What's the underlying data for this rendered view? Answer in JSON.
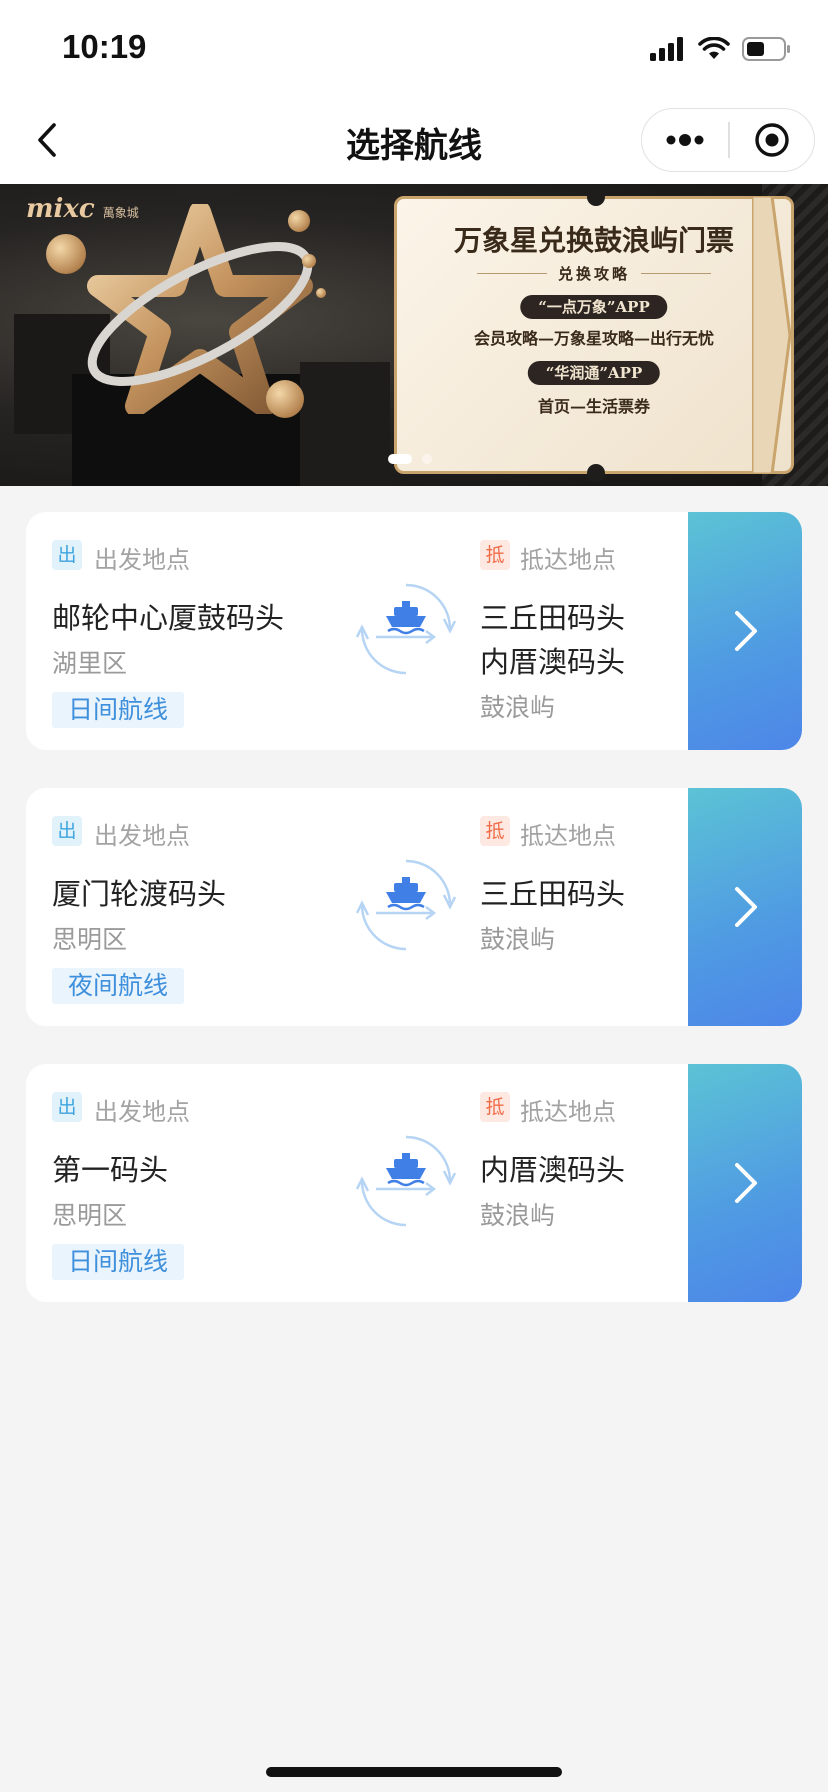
{
  "status_bar": {
    "time": "10:19"
  },
  "nav": {
    "title": "选择航线"
  },
  "banner": {
    "brand": "mixc",
    "brand_sub": "萬象城",
    "headline": "万象星兑换鼓浪屿门票",
    "subtitle": "兑换攻略",
    "app1": "“一点万象”APP",
    "path1": "会员攻略—万象星攻略—出行无忧",
    "app2": "“华润通”APP",
    "path2": "首页—生活票券",
    "slide_count": 2,
    "active_slide": 1
  },
  "labels": {
    "departure_tag": "出",
    "departure_label": "出发地点",
    "arrival_tag": "抵",
    "arrival_label": "抵达地点"
  },
  "routes": [
    {
      "from": "邮轮中心厦鼓码头",
      "from_district": "湖里区",
      "to": [
        "三丘田码头",
        "内厝澳码头"
      ],
      "to_district": "鼓浪屿",
      "type": "日间航线"
    },
    {
      "from": "厦门轮渡码头",
      "from_district": "思明区",
      "to": [
        "三丘田码头"
      ],
      "to_district": "鼓浪屿",
      "type": "夜间航线"
    },
    {
      "from": "第一码头",
      "from_district": "思明区",
      "to": [
        "内厝澳码头"
      ],
      "to_district": "鼓浪屿",
      "type": "日间航线"
    }
  ],
  "colors": {
    "accent_blue": "#3e8fdc",
    "departure_tag": "#3fa4df",
    "arrival_tag": "#f06d4a",
    "go_button_start": "#5cc3d5",
    "go_button_end": "#4d86e8"
  },
  "icons": [
    "back-chevron-icon",
    "more-dots-icon",
    "target-close-icon",
    "ferry-ship-icon",
    "chevron-right-icon",
    "signal-icon",
    "wifi-icon",
    "battery-icon"
  ]
}
